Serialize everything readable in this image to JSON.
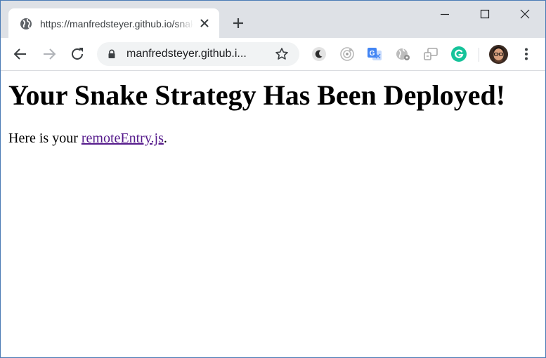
{
  "browser": {
    "tab": {
      "title": "https://manfredsteyer.github.io/snake-strategy/",
      "favicon": "globe-icon",
      "close_icon": "close-icon"
    },
    "new_tab_icon": "plus-icon",
    "window_controls": [
      "minimize-icon",
      "maximize-icon",
      "close-icon"
    ],
    "toolbar": {
      "back_icon": "back-arrow-icon",
      "forward_icon": "forward-arrow-icon",
      "reload_icon": "reload-icon",
      "address": "manfredsteyer.github.i...",
      "lock_icon": "lock-icon",
      "bookmark_icon": "star-icon",
      "extensions": [
        "dark-mode-icon",
        "target-icon",
        "translate-icon",
        "globe-gear-icon",
        "devices-icon",
        "grammarly-icon"
      ],
      "profile_icon": "avatar",
      "menu_icon": "more-vert-icon"
    },
    "colors": {
      "tabstrip": "#dee1e6",
      "omnibox": "#f1f3f4",
      "grammarly": "#15c39a",
      "visited_link": "#551a8b"
    }
  },
  "page": {
    "heading": "Your Snake Strategy Has Been Deployed!",
    "paragraph_prefix": "Here is your ",
    "link_text": "remoteEntry.js",
    "paragraph_suffix": "."
  }
}
